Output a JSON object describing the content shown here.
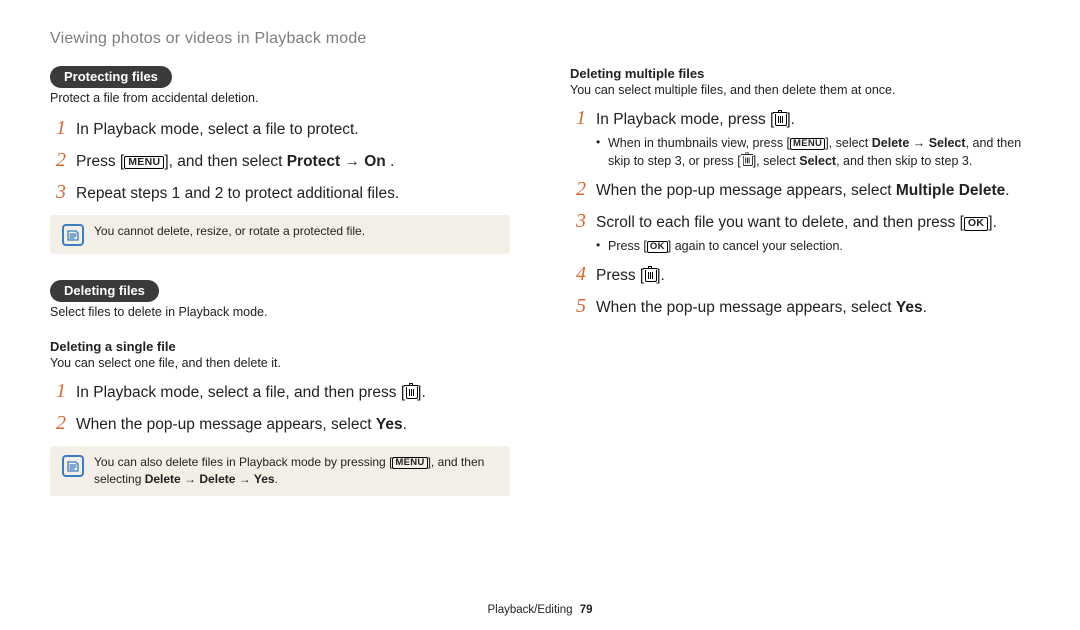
{
  "page_title": "Viewing photos or videos in Playback mode",
  "footer": {
    "section": "Playback/Editing",
    "page": "79"
  },
  "keys": {
    "menu": "MENU",
    "ok": "OK"
  },
  "left": {
    "protect": {
      "pill": "Protecting files",
      "desc": "Protect a file from accidental deletion.",
      "steps": {
        "s1": "In Playback mode, select a file to protect.",
        "s2_a": "Press [",
        "s2_b": "], and then select ",
        "s2_bold": "Protect → On",
        "s2_c": " .",
        "s3": "Repeat steps 1 and 2 to protect additional files."
      },
      "note": "You cannot delete, resize, or rotate a protected file."
    },
    "delete": {
      "pill": "Deleting files",
      "desc": "Select files to delete in Playback mode.",
      "subhead": "Deleting a single file",
      "subdesc": "You can select one file, and then delete it.",
      "steps": {
        "s1_a": "In Playback mode, select a file, and then press [",
        "s1_b": "].",
        "s2_a": "When the pop-up message appears, select ",
        "s2_bold": "Yes",
        "s2_b": "."
      },
      "note_a": "You can also delete files in Playback mode by pressing [",
      "note_b": "], and then selecting ",
      "note_bold": "Delete → Delete → Yes",
      "note_c": "."
    }
  },
  "right": {
    "subhead": "Deleting multiple files",
    "subdesc": "You can select multiple files, and then delete them at once.",
    "steps": {
      "s1_a": "In Playback mode, press [",
      "s1_b": "].",
      "s1_sub_a": "When in thumbnails view, press [",
      "s1_sub_b": "], select ",
      "s1_sub_bold1": "Delete → Select",
      "s1_sub_c": ", and then skip to step 3, or press [",
      "s1_sub_d": "], select ",
      "s1_sub_bold2": "Select",
      "s1_sub_e": ", and then skip to step 3.",
      "s2_a": "When the pop-up message appears, select ",
      "s2_bold": "Multiple Delete",
      "s2_b": ".",
      "s3_a": "Scroll to each file you want to delete, and then press [",
      "s3_b": "].",
      "s3_sub_a": "Press [",
      "s3_sub_b": "] again to cancel your selection.",
      "s4_a": "Press [",
      "s4_b": "].",
      "s5_a": "When the pop-up message appears, select ",
      "s5_bold": "Yes",
      "s5_b": "."
    }
  }
}
